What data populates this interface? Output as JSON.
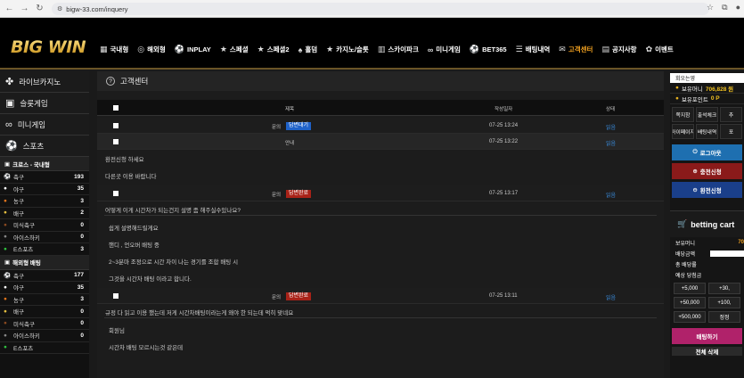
{
  "browser": {
    "url": "bigw-33.com/inquery"
  },
  "logo": "BIG WIN",
  "nav": [
    {
      "label": "국내형",
      "icon": "grid-icon",
      "glyph": "▦"
    },
    {
      "label": "해외형",
      "icon": "globe-icon",
      "glyph": "◎"
    },
    {
      "label": "INPLAY",
      "icon": "ball-icon",
      "glyph": "⚽"
    },
    {
      "label": "스페셜",
      "icon": "star-icon",
      "glyph": "★"
    },
    {
      "label": "스페셜2",
      "icon": "star-icon",
      "glyph": "★"
    },
    {
      "label": "홀덤",
      "icon": "spade-icon",
      "glyph": "♠"
    },
    {
      "label": "카지노/슬롯",
      "icon": "star-icon",
      "glyph": "★"
    },
    {
      "label": "스카이파크",
      "icon": "building-icon",
      "glyph": "▥"
    },
    {
      "label": "미니게임",
      "icon": "gamepad-icon",
      "glyph": "∞"
    },
    {
      "label": "BET365",
      "icon": "ball-icon",
      "glyph": "⚽"
    },
    {
      "label": "배팅내역",
      "icon": "list-icon",
      "glyph": "☰"
    },
    {
      "label": "고객센터",
      "icon": "chat-icon",
      "glyph": "✉",
      "active": true
    },
    {
      "label": "공지사항",
      "icon": "notice-icon",
      "glyph": "▤"
    },
    {
      "label": "이벤트",
      "icon": "gift-icon",
      "glyph": "✿"
    }
  ],
  "sidebar": {
    "big": [
      {
        "label": "라이브카지노",
        "icon": "chip-icon",
        "glyph": "✤"
      },
      {
        "label": "슬롯게임",
        "icon": "slot-icon",
        "glyph": "▣"
      },
      {
        "label": "미니게임",
        "icon": "gamepad-icon",
        "glyph": "∞"
      },
      {
        "label": "스포츠",
        "icon": "ball-icon",
        "glyph": "⚽"
      }
    ],
    "sections": [
      {
        "title": "크로스 - 국내형",
        "items": [
          {
            "label": "축구",
            "count": "193",
            "icon": "soccer-icon",
            "glyph": "⚽",
            "color": "#ffffff"
          },
          {
            "label": "야구",
            "count": "35",
            "icon": "baseball-icon",
            "glyph": "●",
            "color": "#ffffff"
          },
          {
            "label": "농구",
            "count": "3",
            "icon": "basketball-icon",
            "glyph": "●",
            "color": "#e0741c"
          },
          {
            "label": "배구",
            "count": "2",
            "icon": "volleyball-icon",
            "glyph": "●",
            "color": "#e5c040"
          },
          {
            "label": "미식축구",
            "count": "0",
            "icon": "football-icon",
            "glyph": "●",
            "color": "#8a4a20"
          },
          {
            "label": "아이스하키",
            "count": "0",
            "icon": "hockey-icon",
            "glyph": "●",
            "color": "#888888"
          },
          {
            "label": "E스포츠",
            "count": "3",
            "icon": "esports-icon",
            "glyph": "●",
            "color": "#30c040"
          }
        ]
      },
      {
        "title": "해외형 배팅",
        "items": [
          {
            "label": "축구",
            "count": "177",
            "icon": "soccer-icon",
            "glyph": "⚽",
            "color": "#ffffff"
          },
          {
            "label": "야구",
            "count": "35",
            "icon": "baseball-icon",
            "glyph": "●",
            "color": "#ffffff"
          },
          {
            "label": "농구",
            "count": "3",
            "icon": "basketball-icon",
            "glyph": "●",
            "color": "#e0741c"
          },
          {
            "label": "배구",
            "count": "0",
            "icon": "volleyball-icon",
            "glyph": "●",
            "color": "#e5c040"
          },
          {
            "label": "미식축구",
            "count": "0",
            "icon": "football-icon",
            "glyph": "●",
            "color": "#8a4a20"
          },
          {
            "label": "아이스하키",
            "count": "0",
            "icon": "hockey-icon",
            "glyph": "●",
            "color": "#888888"
          },
          {
            "label": "E스포츠",
            "count": "",
            "icon": "esports-icon",
            "glyph": "●",
            "color": "#30c040"
          }
        ]
      }
    ]
  },
  "main": {
    "title": "고객센터",
    "headers": {
      "title": "제목",
      "date": "작성일자",
      "status": "상태"
    },
    "rows": [
      {
        "prefix": "문의",
        "tag": "답변대기",
        "tag_color": "blue",
        "date": "07-25 13:24",
        "status": "읽음",
        "alt": false
      },
      {
        "prefix": "안내",
        "tag": "",
        "tag_color": "",
        "date": "07-25 13:22",
        "status": "읽음",
        "alt": true,
        "body": [
          "환전신청 하세요",
          "다른곳 이용 바랍니다"
        ]
      },
      {
        "prefix": "문의",
        "tag": "답변완료",
        "tag_color": "red",
        "date": "07-25 13:17",
        "status": "읽음",
        "alt": false,
        "question": "어떻게 이게 시간차가 되는건지 설명 좀 해주실수있나요?",
        "body": [
          "쉽게 설명해드릴게요",
          "핸디 , 언오버 배팅 중",
          "2~3분마 조정으로 시간 차이 나는 경기를 조합 배팅 시",
          "그것을 시간차 배팅 이라고 합니다."
        ]
      },
      {
        "prefix": "문의",
        "tag": "답변완료",
        "tag_color": "red",
        "date": "07-25 13:11",
        "status": "읽음",
        "alt": false,
        "question": "규정 다 읽고 이용 했는데 저게 시간차배팅이라는게 왜야 한 되는데 먹히 맞네요",
        "body": [
          "회원님",
          "시간차 배팅 모르시는것 같은데"
        ]
      }
    ]
  },
  "right": {
    "user": "회오는영",
    "money_label": "보유머니",
    "money": "706,828 원",
    "point_label": "보유포인트",
    "point": "0 P",
    "grid": [
      "쪽지함",
      "출석체크",
      "추",
      "마이페이지",
      "배팅내역",
      "포"
    ],
    "logout": "로그아웃",
    "deposit": "충전신청",
    "withdraw": "환전신청",
    "cart_title": "betting cart",
    "cart_money_label": "보유머니",
    "cart_money": "70",
    "bet_amount_label": "배당금액",
    "total_odds_label": "총 배당률",
    "win_amount_label": "예상 당첨금",
    "chips": [
      "+5,000",
      "+30,",
      "+50,000",
      "+100,",
      "+500,000",
      "정정"
    ],
    "bet_button": "배팅하기",
    "delete_button": "전체 삭제"
  }
}
